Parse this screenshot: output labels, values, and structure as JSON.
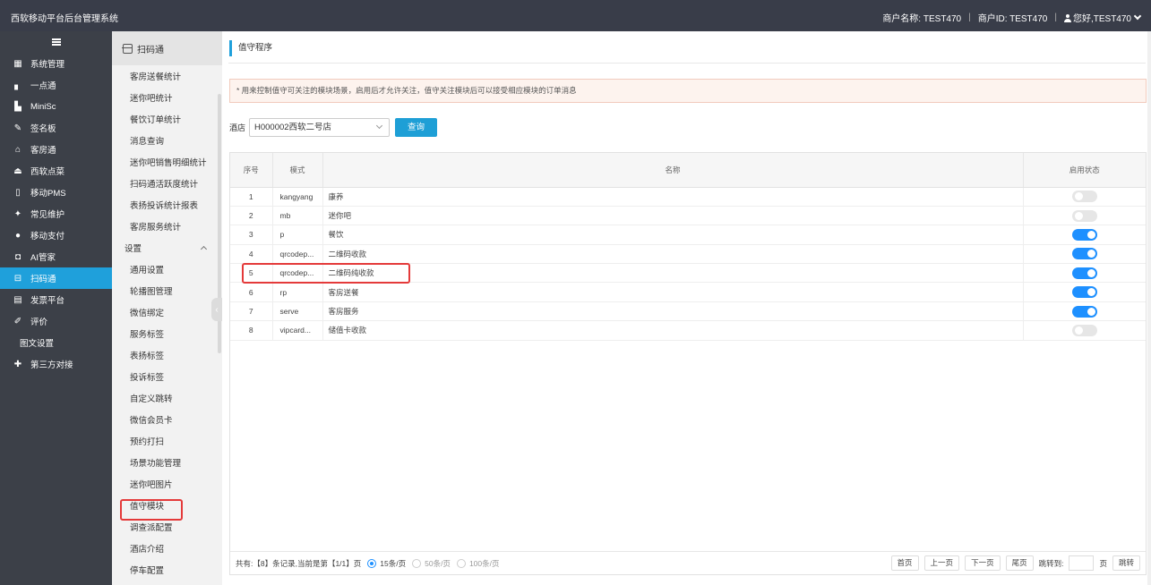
{
  "header": {
    "app_title": "西软移动平台后台管理系统",
    "merchant_name": "商户名称: TEST470",
    "merchant_id": "商户ID: TEST470",
    "greeting": "您好,TEST470",
    "separator": "|"
  },
  "sidebar": {
    "items": [
      {
        "label": "系统管理",
        "icon": "grid-icon",
        "glyph": "▦"
      },
      {
        "label": "一点通",
        "icon": "bar-chart-icon",
        "glyph": "▖"
      },
      {
        "label": "MiniSc",
        "icon": "building-icon",
        "glyph": "▙"
      },
      {
        "label": "签名板",
        "icon": "pen-icon",
        "glyph": "✎"
      },
      {
        "label": "客房通",
        "icon": "home-icon",
        "glyph": "⌂"
      },
      {
        "label": "西软点菜",
        "icon": "eject-icon",
        "glyph": "⏏"
      },
      {
        "label": "移动PMS",
        "icon": "tablet-icon",
        "glyph": "▯"
      },
      {
        "label": "常见维护",
        "icon": "wrench-icon",
        "glyph": "✦"
      },
      {
        "label": "移动支付",
        "icon": "pay-icon",
        "glyph": "●"
      },
      {
        "label": "AI管家",
        "icon": "bag-icon",
        "glyph": "◘"
      },
      {
        "label": "扫码通",
        "icon": "scan-icon",
        "glyph": "⊟"
      },
      {
        "label": "发票平台",
        "icon": "invoice-icon",
        "glyph": "▤"
      },
      {
        "label": "评价",
        "icon": "edit-icon",
        "glyph": "✐"
      },
      {
        "label": "图文设置",
        "icon": "",
        "glyph": ""
      },
      {
        "label": "第三方对接",
        "icon": "puzzle-icon",
        "glyph": "✚"
      }
    ]
  },
  "subnav": {
    "title": "扫码通",
    "items_top": [
      "客房送餐统计",
      "迷你吧统计",
      "餐饮订单统计",
      "消息查询",
      "迷你吧销售明细统计",
      "扫码通活跃度统计",
      "表扬投诉统计报表",
      "客房服务统计"
    ],
    "group": "设置",
    "items_settings": [
      "通用设置",
      "轮播图管理",
      "微信绑定",
      "服务标签",
      "表扬标签",
      "投诉标签",
      "自定义跳转",
      "微信会员卡",
      "预约打扫",
      "场景功能管理",
      "迷你吧图片",
      "值守模块",
      "调查派配置",
      "酒店介绍",
      "停车配置"
    ]
  },
  "main": {
    "page_title": "值守程序",
    "notice": "* 用来控制值守可关注的模块场景，启用后才允许关注，值守关注模块后可以接受相应模块的订单消息",
    "hotel_label": "酒店",
    "hotel_value": "H000002西软二号店",
    "query_label": "查询"
  },
  "table": {
    "headers": [
      "序号",
      "模式",
      "名称",
      "启用状态"
    ],
    "rows": [
      {
        "no": "1",
        "mode": "kangyang",
        "name": "康养",
        "enabled": false
      },
      {
        "no": "2",
        "mode": "mb",
        "name": "迷你吧",
        "enabled": false
      },
      {
        "no": "3",
        "mode": "p",
        "name": "餐饮",
        "enabled": true
      },
      {
        "no": "4",
        "mode": "qrcodep...",
        "name": "二维码收款",
        "enabled": true
      },
      {
        "no": "5",
        "mode": "qrcodep...",
        "name": "二维码纯收款",
        "enabled": true
      },
      {
        "no": "6",
        "mode": "rp",
        "name": "客房送餐",
        "enabled": true
      },
      {
        "no": "7",
        "mode": "serve",
        "name": "客房服务",
        "enabled": true
      },
      {
        "no": "8",
        "mode": "vipcard...",
        "name": "储值卡收款",
        "enabled": false
      }
    ]
  },
  "pager": {
    "summary": "共有:【8】条记录,当前是第【1/1】页",
    "size_options": [
      "15条/页",
      "50条/页",
      "100条/页"
    ],
    "selected_size": "15条/页",
    "first": "首页",
    "prev": "上一页",
    "next": "下一页",
    "last": "尾页",
    "jump_label": "跳转到:",
    "page_unit": "页",
    "jump_button": "跳转"
  },
  "colors": {
    "topbar": "#393d49",
    "sidebar": "#3c4048",
    "accent": "#1fa0db",
    "toggle_on": "#1e90ff",
    "highlight": "#e43a3a"
  }
}
